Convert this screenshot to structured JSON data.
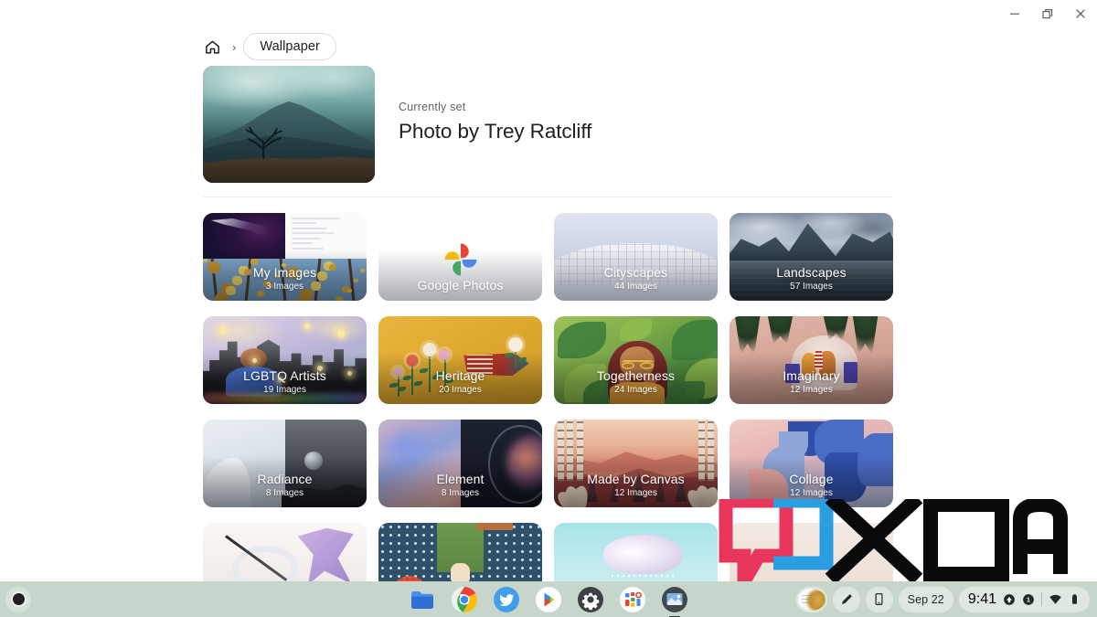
{
  "window": {
    "controls": [
      {
        "name": "minimize",
        "glyph": "minimize-icon"
      },
      {
        "name": "restore",
        "glyph": "restore-icon"
      },
      {
        "name": "close",
        "glyph": "close-icon"
      }
    ]
  },
  "breadcrumb": {
    "home_icon": "home-icon",
    "separator": "›",
    "current": "Wallpaper"
  },
  "current_wallpaper": {
    "status_label": "Currently set",
    "title": "Photo by Trey Ratcliff"
  },
  "collections": [
    {
      "name": "My Images",
      "count": "3 Images",
      "art": "a-myimages",
      "light": false
    },
    {
      "name": "Google Photos",
      "count": "",
      "art": "a-gphotos",
      "light": true
    },
    {
      "name": "Cityscapes",
      "count": "44 Images",
      "art": "a-city",
      "light": true
    },
    {
      "name": "Landscapes",
      "count": "57 Images",
      "art": "a-land",
      "light": false
    },
    {
      "name": "LGBTQ Artists",
      "count": "19 Images",
      "art": "a-lgbtq",
      "light": false
    },
    {
      "name": "Heritage",
      "count": "20 Images",
      "art": "a-heritage",
      "light": false
    },
    {
      "name": "Togetherness",
      "count": "24 Images",
      "art": "a-together",
      "light": false
    },
    {
      "name": "Imaginary",
      "count": "12 Images",
      "art": "a-imaginary",
      "light": false
    },
    {
      "name": "Radiance",
      "count": "8 Images",
      "art": "a-radiance",
      "light": false
    },
    {
      "name": "Element",
      "count": "8 Images",
      "art": "a-element",
      "light": false
    },
    {
      "name": "Made by Canvas",
      "count": "12 Images",
      "art": "a-canvas",
      "light": false
    },
    {
      "name": "Collage",
      "count": "12 Images",
      "art": "a-collage",
      "light": false
    },
    {
      "name": "",
      "count": "",
      "art": "a-r4a",
      "light": false
    },
    {
      "name": "",
      "count": "",
      "art": "a-r4b",
      "light": false
    },
    {
      "name": "",
      "count": "",
      "art": "a-r4c",
      "light": false
    },
    {
      "name": "",
      "count": "",
      "art": "a-r4d",
      "light": false
    }
  ],
  "watermark": {
    "text": "XDA"
  },
  "shelf": {
    "launcher_icon": "launcher-icon",
    "apps": [
      {
        "icon": "files-icon",
        "active": false
      },
      {
        "icon": "chrome-icon",
        "active": false
      },
      {
        "icon": "twitter-icon",
        "active": false
      },
      {
        "icon": "play-store-icon",
        "active": false
      },
      {
        "icon": "settings-icon",
        "active": false
      },
      {
        "icon": "app-grid-icon",
        "active": false
      },
      {
        "icon": "wallpaper-app-icon",
        "active": true
      }
    ],
    "status": {
      "avatar": "user-avatar",
      "stylus_icon": "stylus-icon",
      "phone_hub_icon": "phone-hub-icon",
      "date": "Sep 22",
      "time": "9:41",
      "upload_badge": "upload-badge-icon",
      "notification_count": "1",
      "wifi_icon": "wifi-icon",
      "battery_icon": "battery-icon"
    }
  },
  "colors": {
    "shelf_bg": "#c7d6cb",
    "text_primary": "#202124",
    "text_secondary": "#5f6368",
    "divider": "#e8eaed",
    "xda_pink": "#e8365c",
    "xda_blue": "#2a9ee0"
  }
}
